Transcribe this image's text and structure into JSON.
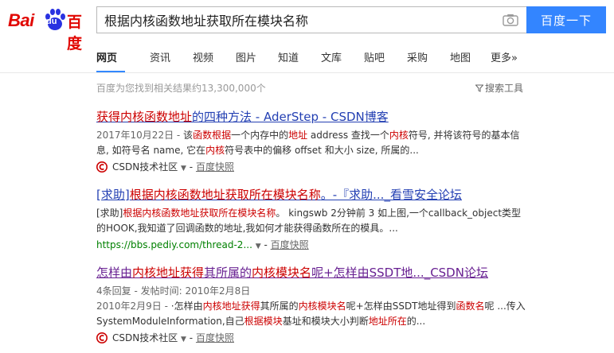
{
  "header": {
    "logo_bai": "Bai",
    "logo_du": "du",
    "logo_cn": "百度",
    "search_query": "根据内核函数地址获取所在模块名称",
    "search_button": "百度一下",
    "camera_icon": "camera-icon"
  },
  "nav": {
    "tabs": [
      "网页",
      "资讯",
      "视频",
      "图片",
      "知道",
      "文库",
      "贴吧",
      "采购",
      "地图",
      "更多»"
    ],
    "active": 0
  },
  "stats": {
    "result_count": "百度为您找到相关结果约13,300,000个",
    "tools": "搜索工具"
  },
  "results": [
    {
      "title_parts": [
        {
          "t": "获得内核函数地址",
          "em": true
        },
        {
          "t": "的四种方法 - AderStep - CSDN博客",
          "em": false
        }
      ],
      "abstract_parts": [
        {
          "t": "2017年10月22日 - ",
          "date": true
        },
        {
          "t": "该",
          "em": false
        },
        {
          "t": "函数根据",
          "em": true
        },
        {
          "t": "一个内存中的",
          "em": false
        },
        {
          "t": "地址",
          "em": true
        },
        {
          "t": " address 查找一个",
          "em": false
        },
        {
          "t": "内核",
          "em": true
        },
        {
          "t": "符号, 并将该符号的基本信息, 如符号名 name, 它在",
          "em": false
        },
        {
          "t": "内核",
          "em": true
        },
        {
          "t": "符号表中的偏移 offset 和大小 size, 所属的...",
          "em": false
        }
      ],
      "source_name": "CSDN技术社区",
      "cache": "百度快照",
      "visited": false
    },
    {
      "title_parts": [
        {
          "t": "[求助]",
          "em": false
        },
        {
          "t": "根据内核函数地址获取所在模块名称",
          "em": true
        },
        {
          "t": "。-『求助..._看雪安全论坛",
          "em": false
        }
      ],
      "abstract_parts": [
        {
          "t": "[求助]",
          "em": false
        },
        {
          "t": "根据内核函数地址获取所在模块名称",
          "em": true
        },
        {
          "t": "。 kingswb 2分钟前 3 如上图,一个callback_object类型的HOOK,我知道了回调函数的地址,我如何才能获得函数所在的模具。...",
          "em": false
        }
      ],
      "url": "https://bbs.pediy.com/thread-2...",
      "cache": "百度快照",
      "visited": false
    },
    {
      "title_parts": [
        {
          "t": "怎样由",
          "em": false
        },
        {
          "t": "内核地址获得",
          "em": true
        },
        {
          "t": "其所属的",
          "em": false
        },
        {
          "t": "内核模块名",
          "em": true
        },
        {
          "t": "呢+怎样由SSDT地..._CSDN论坛",
          "em": false
        }
      ],
      "meta": "4条回复 - 发帖时间: 2010年2月8日",
      "abstract_parts": [
        {
          "t": "2010年2月9日 - ",
          "date": true
        },
        {
          "t": "·怎样由",
          "em": false
        },
        {
          "t": "内核地址获得",
          "em": true
        },
        {
          "t": "其所属的",
          "em": false
        },
        {
          "t": "内核模块名",
          "em": true
        },
        {
          "t": "呢+怎样由SSDT地址得到",
          "em": false
        },
        {
          "t": "函数名",
          "em": true
        },
        {
          "t": "呢 ...传入SystemModuleInformation,自己",
          "em": false
        },
        {
          "t": "根据模块",
          "em": true
        },
        {
          "t": "基址和模块大小判断",
          "em": false
        },
        {
          "t": "地址所在",
          "em": true
        },
        {
          "t": "的...",
          "em": false
        }
      ],
      "source_name": "CSDN技术社区",
      "cache": "百度快照",
      "visited": true
    }
  ],
  "colors": {
    "brand_red": "#e10601",
    "brand_blue": "#2932e1",
    "button_blue": "#3385ff",
    "link_blue": "#2440b3",
    "visited": "#671f91",
    "highlight": "#cc0000",
    "url_green": "#008000"
  }
}
